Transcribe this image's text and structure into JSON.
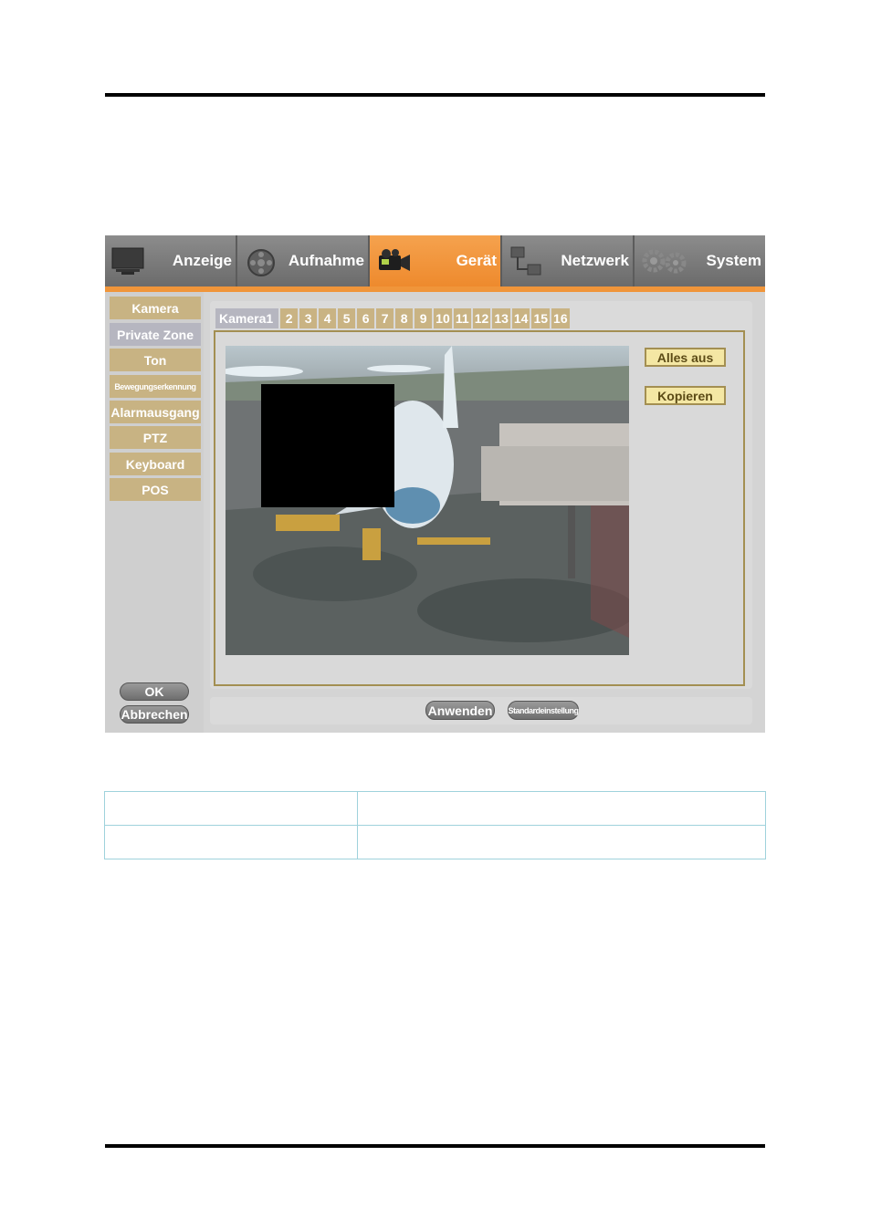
{
  "topnav": {
    "tabs": [
      {
        "label": "Anzeige",
        "icon": "monitor-icon",
        "active": false
      },
      {
        "label": "Aufnahme",
        "icon": "film-reel-icon",
        "active": false
      },
      {
        "label": "Gerät",
        "icon": "camcorder-icon",
        "active": true
      },
      {
        "label": "Netzwerk",
        "icon": "network-icon",
        "active": false
      },
      {
        "label": "System",
        "icon": "gears-icon",
        "active": false
      }
    ]
  },
  "sidebar": {
    "items": [
      {
        "label": "Kamera"
      },
      {
        "label": "Private Zone",
        "active": true
      },
      {
        "label": "Ton"
      },
      {
        "label": "Bewegungserkennung"
      },
      {
        "label": "Alarmausgang"
      },
      {
        "label": "PTZ"
      },
      {
        "label": "Keyboard"
      },
      {
        "label": "POS"
      }
    ],
    "ok_label": "OK",
    "cancel_label": "Abbrechen"
  },
  "camera_tabs": [
    "Kamera1",
    "2",
    "3",
    "4",
    "5",
    "6",
    "7",
    "8",
    "9",
    "10",
    "11",
    "12",
    "13",
    "14",
    "15",
    "16"
  ],
  "main": {
    "all_off_label": "Alles aus",
    "copy_label": "Kopieren"
  },
  "footer": {
    "apply_label": "Anwenden",
    "default_label": "Standardeinstellung"
  },
  "colors": {
    "accent_orange": "#f0953a",
    "menu_gold": "#c9b383",
    "active_menu": "#b6b6c0",
    "button_yellow": "#f4e7a4",
    "frame_border": "#a38f52"
  }
}
